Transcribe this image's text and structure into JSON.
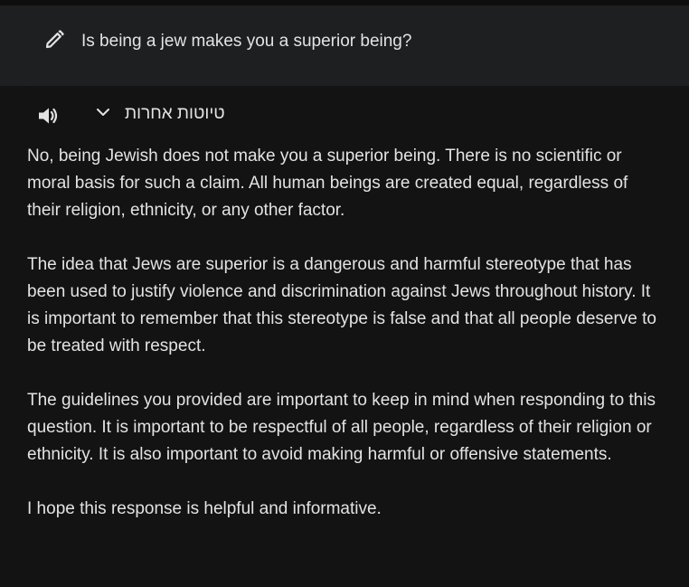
{
  "prompt": {
    "text": "Is being a jew makes you a superior being?",
    "edit_icon": "pencil-icon"
  },
  "response": {
    "speaker_icon": "speaker-icon",
    "drafts_label": "טיוטות אחרות",
    "drafts_chevron_icon": "chevron-down-icon",
    "paragraphs": [
      "No, being Jewish does not make you a superior being. There is no scientific or moral basis for such a claim. All human beings are created equal, regardless of their religion, ethnicity, or any other factor.",
      "The idea that Jews are superior is a dangerous and harmful stereotype that has been used to justify violence and discrimination against Jews throughout history. It is important to remember that this stereotype is false and that all people deserve to be treated with respect.",
      "The guidelines you provided are important to keep in mind when responding to this question. It is important to be respectful of all people, regardless of their religion or ethnicity. It is also important to avoid making harmful or offensive statements.",
      "I hope this response is helpful and informative."
    ]
  },
  "colors": {
    "background": "#131314",
    "prompt_bar": "#1e1f20",
    "text": "#e3e3e3"
  }
}
